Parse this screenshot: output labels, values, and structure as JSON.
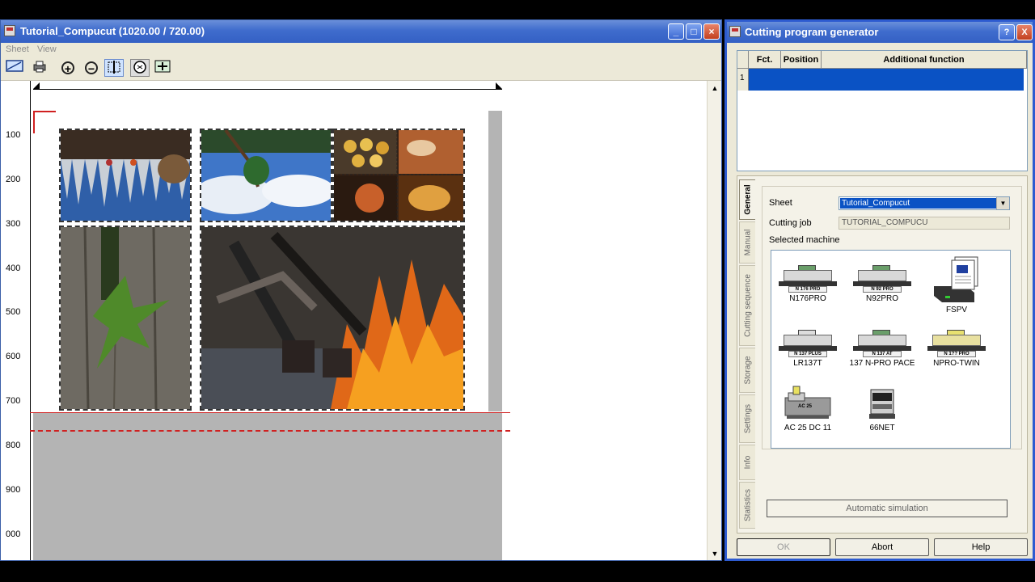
{
  "left_window": {
    "title": "Tutorial_Compucut (1020.00 /  720.00)",
    "menu": [
      "Sheet",
      "View"
    ],
    "toolbar": {
      "icons": [
        "sheet-view-icon",
        "print-icon",
        "zoom-in-icon",
        "zoom-out-icon",
        "fit-width-icon",
        "fit-page-icon",
        "zoom-all-icon"
      ],
      "zoom_in": "+",
      "zoom_out": "−"
    },
    "ruler_labels": [
      "100",
      "200",
      "300",
      "400",
      "500",
      "600",
      "700",
      "800",
      "900",
      "000"
    ],
    "photos": [
      {
        "name": "photo-icicles"
      },
      {
        "name": "photo-sky-branch"
      },
      {
        "name": "photo-food-collage"
      },
      {
        "name": "photo-wood-leaf"
      },
      {
        "name": "photo-fire"
      }
    ]
  },
  "dialog": {
    "title": "Cutting program generator",
    "help_btn": "?",
    "close_btn": "X",
    "table": {
      "columns": [
        "Fct.",
        "Position",
        "Additional function"
      ],
      "rows": [
        {
          "num": "1"
        }
      ]
    },
    "tabs": [
      "General",
      "Manual",
      "Cutting sequence",
      "Storage",
      "Settings",
      "Info",
      "Statistics"
    ],
    "general": {
      "sheet_label": "Sheet",
      "sheet_value": "Tutorial_Compucut",
      "cutting_job_label": "Cutting job",
      "cutting_job_value": "TUTORIAL_COMPUCU",
      "selected_machine_label": "Selected machine",
      "machines": [
        {
          "name": "N176PRO",
          "plate": "N 176 PRO"
        },
        {
          "name": "N92PRO",
          "plate": "N 92 PRO"
        },
        {
          "name": "FSPV",
          "plate": ""
        },
        {
          "name": "LR137T",
          "plate": "N 137 PLUS"
        },
        {
          "name": "137 N-PRO PACE",
          "plate": "N 137 AT"
        },
        {
          "name": "NPRO-TWIN",
          "plate": "N 1?? PRO"
        },
        {
          "name": "AC 25 DC 11",
          "plate": "AC 25"
        },
        {
          "name": "66NET",
          "plate": ""
        }
      ],
      "automatic_simulation": "Automatic simulation"
    },
    "buttons": {
      "ok": "OK",
      "abort": "Abort",
      "help": "Help"
    }
  },
  "colors": {
    "titlebar": "#3f6ccd",
    "selection": "#0a52c4",
    "cutline": "#d02020"
  }
}
